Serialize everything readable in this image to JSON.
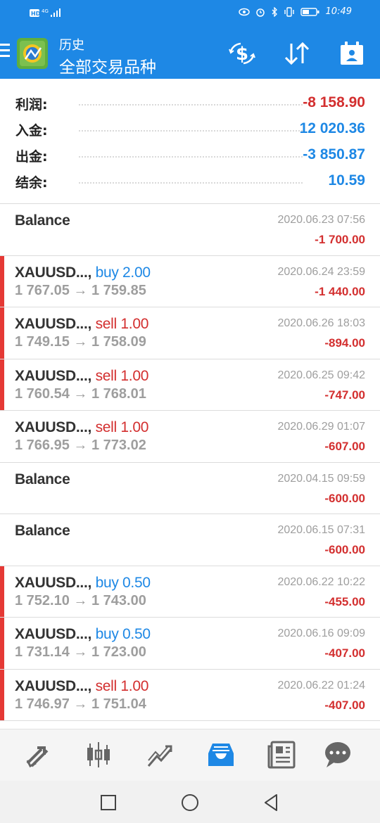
{
  "status_bar": {
    "network": "HD 4G",
    "time": "10:49"
  },
  "app_bar": {
    "title": "历史",
    "subtitle": "全部交易品种"
  },
  "icons": {
    "menu": "hamburger-icon",
    "logo": "metatrader-logo",
    "dollar_swap": "dollar-swap-icon",
    "sort": "sort-icon",
    "calendar": "calendar-icon"
  },
  "summary": [
    {
      "label": "利润:",
      "value": "-8 158.90",
      "tone": "neg"
    },
    {
      "label": "入金:",
      "value": "12 020.36",
      "tone": "pos"
    },
    {
      "label": "出金:",
      "value": "-3 850.87",
      "tone": "pos"
    },
    {
      "label": "结余:",
      "value": "10.59",
      "tone": "pos"
    }
  ],
  "deals": [
    {
      "symbol": "Balance",
      "type": "",
      "type_class": "",
      "price": "",
      "time": "2020.06.23 07:56",
      "profit": "-1 700.00",
      "marker": false
    },
    {
      "symbol": "XAUUSD...,",
      "type": "buy 2.00",
      "type_class": "buy",
      "price": "1 767.05 → 1 759.85",
      "time": "2020.06.24 23:59",
      "profit": "-1 440.00",
      "marker": true
    },
    {
      "symbol": "XAUUSD...,",
      "type": "sell 1.00",
      "type_class": "sell",
      "price": "1 749.15 → 1 758.09",
      "time": "2020.06.26 18:03",
      "profit": "-894.00",
      "marker": true
    },
    {
      "symbol": "XAUUSD...,",
      "type": "sell 1.00",
      "type_class": "sell",
      "price": "1 760.54 → 1 768.01",
      "time": "2020.06.25 09:42",
      "profit": "-747.00",
      "marker": true
    },
    {
      "symbol": "XAUUSD...,",
      "type": "sell 1.00",
      "type_class": "sell",
      "price": "1 766.95 → 1 773.02",
      "time": "2020.06.29 01:07",
      "profit": "-607.00",
      "marker": false
    },
    {
      "symbol": "Balance",
      "type": "",
      "type_class": "",
      "price": "",
      "time": "2020.04.15 09:59",
      "profit": "-600.00",
      "marker": false
    },
    {
      "symbol": "Balance",
      "type": "",
      "type_class": "",
      "price": "",
      "time": "2020.06.15 07:31",
      "profit": "-600.00",
      "marker": false
    },
    {
      "symbol": "XAUUSD...,",
      "type": "buy 0.50",
      "type_class": "buy",
      "price": "1 752.10 → 1 743.00",
      "time": "2020.06.22 10:22",
      "profit": "-455.00",
      "marker": true
    },
    {
      "symbol": "XAUUSD...,",
      "type": "buy 0.50",
      "type_class": "buy",
      "price": "1 731.14 → 1 723.00",
      "time": "2020.06.16 09:09",
      "profit": "-407.00",
      "marker": true
    },
    {
      "symbol": "XAUUSD...,",
      "type": "sell 1.00",
      "type_class": "sell",
      "price": "1 746.97 → 1 751.04",
      "time": "2020.06.22 01:24",
      "profit": "-407.00",
      "marker": true
    }
  ],
  "tab_bar": [
    {
      "name": "quotes-tab",
      "icon": "arrows-diagonal-icon",
      "active": false
    },
    {
      "name": "chart-tab",
      "icon": "candlestick-icon",
      "active": false
    },
    {
      "name": "trade-tab",
      "icon": "trend-line-icon",
      "active": false
    },
    {
      "name": "history-tab",
      "icon": "inbox-tray-icon",
      "active": true
    },
    {
      "name": "news-tab",
      "icon": "newspaper-icon",
      "active": false
    },
    {
      "name": "messages-tab",
      "icon": "chat-bubble-icon",
      "active": false
    }
  ],
  "colors": {
    "primary": "#1e88e5",
    "negative": "#d32f2f",
    "marker": "#e53935",
    "muted": "#9e9e9e"
  }
}
